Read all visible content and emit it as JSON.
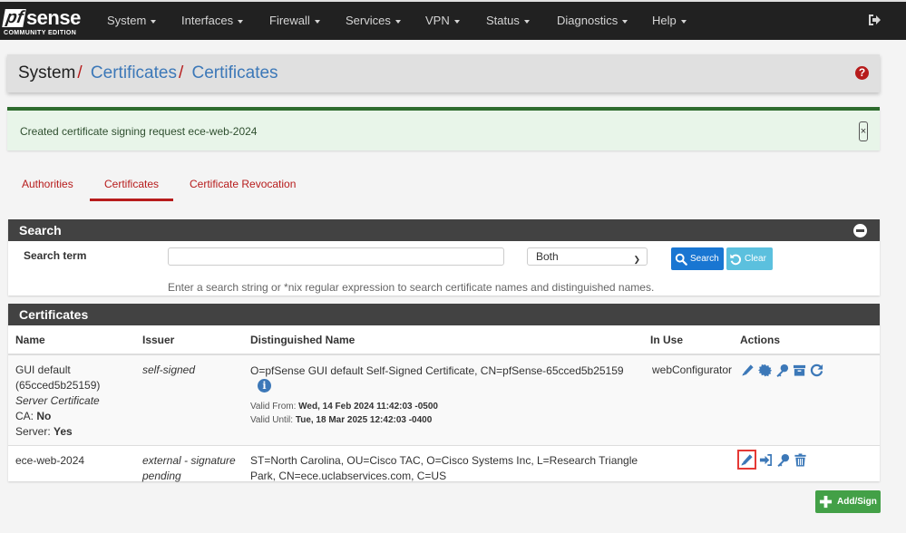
{
  "brand": {
    "name_prefix": "pf",
    "name_suffix": "sense",
    "edition": "COMMUNITY EDITION"
  },
  "nav": {
    "items": [
      {
        "label": "System"
      },
      {
        "label": "Interfaces"
      },
      {
        "label": "Firewall"
      },
      {
        "label": "Services"
      },
      {
        "label": "VPN"
      },
      {
        "label": "Status"
      },
      {
        "label": "Diagnostics"
      },
      {
        "label": "Help"
      }
    ],
    "logout_icon": "sign-out-icon"
  },
  "breadcrumb": {
    "root": "System",
    "level1": "Certificates",
    "level2": "Certificates",
    "separator": "/"
  },
  "help_icon": "?",
  "alert": {
    "message": "Created certificate signing request ece-web-2024",
    "close": "×"
  },
  "tabs": [
    {
      "label": "Authorities",
      "active": false
    },
    {
      "label": "Certificates",
      "active": true
    },
    {
      "label": "Certificate Revocation",
      "active": false
    }
  ],
  "search": {
    "title": "Search",
    "term_label": "Search term",
    "term_value": "",
    "scope_selected": "Both",
    "search_button": "Search",
    "clear_button": "Clear",
    "hint": "Enter a search string or *nix regular expression to search certificate names and distinguished names."
  },
  "certificates": {
    "title": "Certificates",
    "columns": [
      "Name",
      "Issuer",
      "Distinguished Name",
      "In Use",
      "Actions"
    ],
    "rows": [
      {
        "name": "GUI default",
        "id": "(65cced5b25159)",
        "type": "Server Certificate",
        "ca_label": "CA:",
        "ca_value": "No",
        "server_label": "Server:",
        "server_value": "Yes",
        "issuer": "self-signed",
        "dn": "O=pfSense GUI default Self-Signed Certificate, CN=pfSense-65cced5b25159",
        "valid_from_label": "Valid From:",
        "valid_from": "Wed, 14 Feb 2024 11:42:03 -0500",
        "valid_until_label": "Valid Until:",
        "valid_until": "Tue, 18 Mar 2025 12:42:03 -0400",
        "in_use": "webConfigurator",
        "actions": [
          "edit-icon",
          "certificate-icon",
          "key-icon",
          "archive-icon",
          "renew-icon"
        ]
      },
      {
        "name": "ece-web-2024",
        "issuer": "external - signature pending",
        "dn": "ST=North Carolina, OU=Cisco TAC, O=Cisco Systems Inc, L=Research Triangle Park, CN=ece.uclabservices.com, C=US",
        "in_use": "",
        "actions": [
          "edit-icon",
          "sign-in-icon",
          "key-icon",
          "trash-icon"
        ]
      }
    ]
  },
  "add_button": "Add/Sign"
}
